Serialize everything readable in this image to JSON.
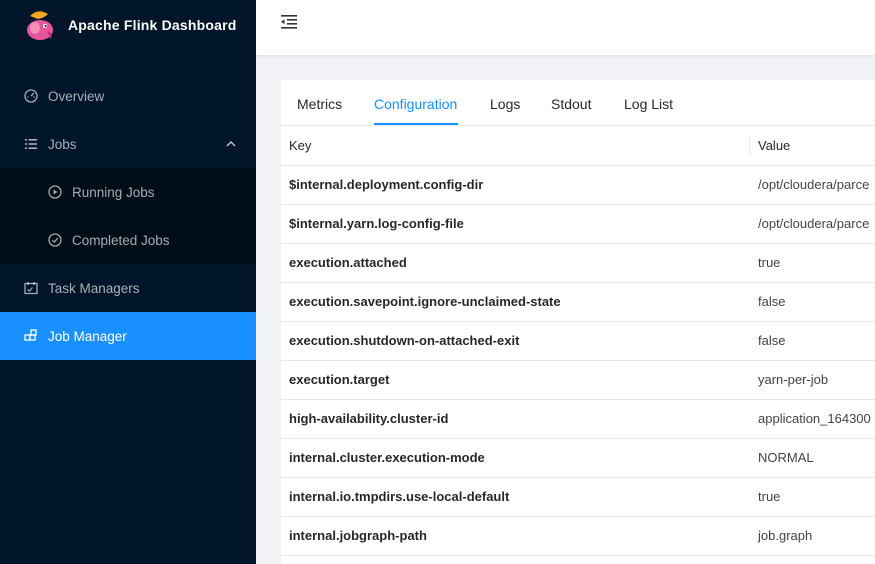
{
  "brand": {
    "title": "Apache Flink Dashboard"
  },
  "sidebar": {
    "items": [
      {
        "label": "Overview",
        "icon": "dashboard-icon"
      },
      {
        "label": "Jobs",
        "icon": "list-icon"
      },
      {
        "label": "Running Jobs",
        "icon": "play-circle-icon"
      },
      {
        "label": "Completed Jobs",
        "icon": "check-circle-icon"
      },
      {
        "label": "Task Managers",
        "icon": "schedule-icon"
      },
      {
        "label": "Job Manager",
        "icon": "build-icon"
      }
    ],
    "selected": "Job Manager",
    "accent_color": "#1890ff",
    "background_color": "#001529"
  },
  "header": {
    "fold_icon": "menu-fold-icon"
  },
  "tabs": [
    {
      "label": "Metrics"
    },
    {
      "label": "Configuration"
    },
    {
      "label": "Logs"
    },
    {
      "label": "Stdout"
    },
    {
      "label": "Log List"
    }
  ],
  "active_tab": "Configuration",
  "table": {
    "columns": [
      "Key",
      "Value"
    ],
    "rows": [
      {
        "key": "$internal.deployment.config-dir",
        "value": "/opt/cloudera/parce"
      },
      {
        "key": "$internal.yarn.log-config-file",
        "value": "/opt/cloudera/parce"
      },
      {
        "key": "execution.attached",
        "value": "true"
      },
      {
        "key": "execution.savepoint.ignore-unclaimed-state",
        "value": "false"
      },
      {
        "key": "execution.shutdown-on-attached-exit",
        "value": "false"
      },
      {
        "key": "execution.target",
        "value": "yarn-per-job"
      },
      {
        "key": "high-availability.cluster-id",
        "value": "application_164300"
      },
      {
        "key": "internal.cluster.execution-mode",
        "value": "NORMAL"
      },
      {
        "key": "internal.io.tmpdirs.use-local-default",
        "value": "true"
      },
      {
        "key": "internal.jobgraph-path",
        "value": "job.graph"
      }
    ]
  }
}
